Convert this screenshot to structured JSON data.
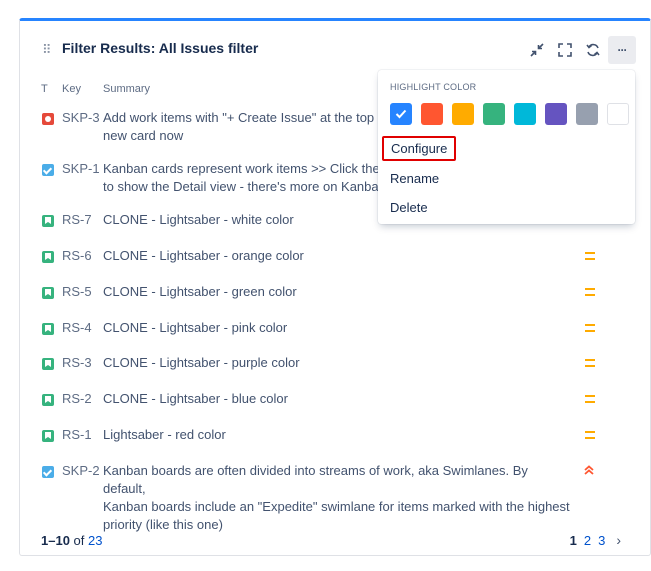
{
  "gadget": {
    "title": "Filter Results: All Issues filter",
    "actions": [
      {
        "name": "minimize-icon"
      },
      {
        "name": "fullscreen-icon"
      },
      {
        "name": "refresh-icon"
      },
      {
        "name": "more-icon",
        "label": "···"
      }
    ]
  },
  "table": {
    "headers": {
      "type": "T",
      "key": "Key",
      "summary": "Summary"
    },
    "rows": [
      {
        "type": "bug",
        "key": "SKP-3",
        "summary": "Add work items with \"+ Create Issue\" at the top ri",
        "summary2": "new card now",
        "priority": "none"
      },
      {
        "type": "task",
        "key": "SKP-1",
        "summary": "Kanban cards represent work items >> Click the \"",
        "summary2": "to show the Detail view - there's more on Kanban",
        "priority": "none"
      },
      {
        "type": "story",
        "key": "RS-7",
        "summary": "CLONE - Lightsaber - white color",
        "priority": "medium"
      },
      {
        "type": "story",
        "key": "RS-6",
        "summary": "CLONE - Lightsaber - orange color",
        "priority": "medium"
      },
      {
        "type": "story",
        "key": "RS-5",
        "summary": "CLONE - Lightsaber - green color",
        "priority": "medium"
      },
      {
        "type": "story",
        "key": "RS-4",
        "summary": "CLONE - Lightsaber - pink color",
        "priority": "medium"
      },
      {
        "type": "story",
        "key": "RS-3",
        "summary": "CLONE - Lightsaber - purple color",
        "priority": "medium"
      },
      {
        "type": "story",
        "key": "RS-2",
        "summary": "CLONE - Lightsaber - blue color",
        "priority": "medium"
      },
      {
        "type": "story",
        "key": "RS-1",
        "summary": "Lightsaber - red color",
        "priority": "medium"
      },
      {
        "type": "task",
        "key": "SKP-2",
        "summary": "Kanban boards are often divided into streams of work, aka Swimlanes. By default,",
        "summary2": "Kanban boards include an \"Expedite\" swimlane for items marked with the highest",
        "summary3": "priority (like this one)",
        "priority": "highest"
      }
    ]
  },
  "footer": {
    "range": "1–10",
    "of": "of",
    "total": "23",
    "pages": [
      "1",
      "2",
      "3"
    ],
    "current_page": "1",
    "next": "›"
  },
  "dropdown": {
    "heading": "HIGHLIGHT COLOR",
    "colors": [
      "#2684ff",
      "#ff5630",
      "#ffab00",
      "#36b37e",
      "#00b8d9",
      "#6554c0",
      "#97a0af",
      "#ffffff"
    ],
    "selected_color": "#2684ff",
    "items": [
      "Configure",
      "Rename",
      "Delete"
    ]
  },
  "colors": {
    "accent": "#2684ff",
    "link": "#0052cc",
    "priority_medium": "#ffab00",
    "priority_highest": "#ff5630",
    "highlight_box": "#e00000"
  }
}
